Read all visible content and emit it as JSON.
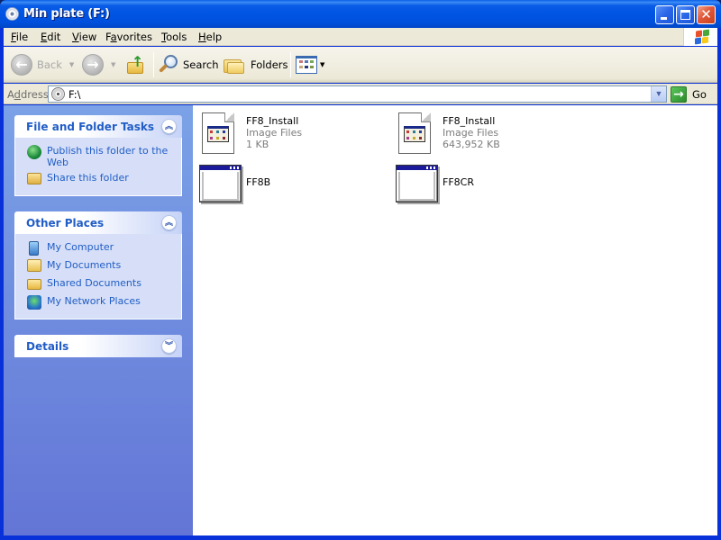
{
  "window": {
    "title": "Min plate (F:)",
    "title_icon": "cd-drive-icon",
    "controls": [
      "minimize",
      "maximize",
      "close"
    ],
    "close_glyph": "✕"
  },
  "menubar": {
    "items": [
      {
        "label": "File",
        "mnemonic": "F",
        "rest": "ile"
      },
      {
        "label": "Edit",
        "mnemonic": "E",
        "rest": "dit"
      },
      {
        "label": "View",
        "mnemonic": "V",
        "rest": "iew"
      },
      {
        "label": "Favorites",
        "pre": "F",
        "mnemonic": "a",
        "rest": "vorites"
      },
      {
        "label": "Tools",
        "mnemonic": "T",
        "rest": "ools"
      },
      {
        "label": "Help",
        "mnemonic": "H",
        "rest": "elp"
      }
    ]
  },
  "toolbar": {
    "back_label": "Back",
    "back_glyph": "←",
    "forward_glyph": "→",
    "dropdown_glyph": "▼",
    "up_glyph": "↑",
    "search_label": "Search",
    "folders_label": "Folders"
  },
  "address": {
    "label_pre": "A",
    "label_mnemonic": "d",
    "label_rest": "dress",
    "value": "F:\\",
    "dropdown_glyph": "▼",
    "go_label": "Go",
    "go_glyph": "→"
  },
  "sidebar": {
    "panels": [
      {
        "title": "File and Folder Tasks",
        "chevron": "︽",
        "items": [
          {
            "label": "Publish this folder to the Web",
            "icon": "publish-web-icon"
          },
          {
            "label": "Share this folder",
            "icon": "share-folder-icon"
          }
        ]
      },
      {
        "title": "Other Places",
        "chevron": "︽",
        "items": [
          {
            "label": "My Computer",
            "icon": "my-computer-icon"
          },
          {
            "label": "My Documents",
            "icon": "my-documents-icon"
          },
          {
            "label": "Shared Documents",
            "icon": "shared-documents-icon"
          },
          {
            "label": "My Network Places",
            "icon": "network-places-icon"
          }
        ]
      },
      {
        "title": "Details",
        "chevron": "︾",
        "items": []
      }
    ]
  },
  "files": [
    {
      "name": "FF8_Install",
      "type": "Image Files",
      "size": "1 KB",
      "icon": "image-file-icon"
    },
    {
      "name": "FF8_Install",
      "type": "Image Files",
      "size": "643,952 KB",
      "icon": "image-file-icon"
    },
    {
      "name": "FF8B",
      "type": "",
      "size": "",
      "icon": "application-icon"
    },
    {
      "name": "FF8CR",
      "type": "",
      "size": "",
      "icon": "application-icon"
    }
  ],
  "colors": {
    "titlebar": "#0054e3",
    "sidebar_bg": "#6375d6",
    "panel_title": "#215dc6",
    "task_link": "#215dc6",
    "panel_body": "#d6dff7"
  }
}
